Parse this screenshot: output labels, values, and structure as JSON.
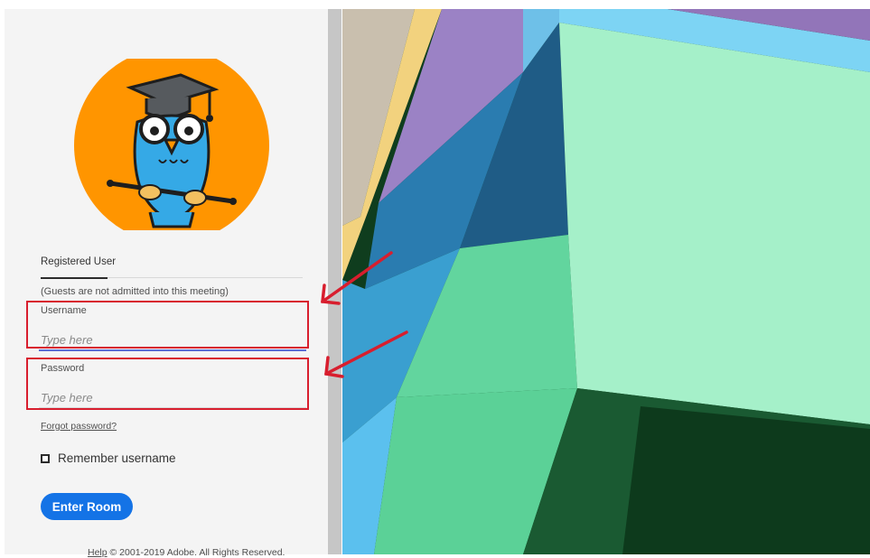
{
  "login": {
    "tab_label": "Registered User",
    "guest_note": "(Guests are not admitted into this meeting)",
    "username": {
      "label": "Username",
      "placeholder": "Type here",
      "value": ""
    },
    "password": {
      "label": "Password",
      "placeholder": "Type here",
      "value": ""
    },
    "forgot_password": "Forgot password?",
    "remember_username": {
      "label": "Remember username",
      "checked": false
    },
    "enter_button": "Enter Room"
  },
  "footer": {
    "help": "Help",
    "copyright": " © 2001-2019 Adobe. All Rights Reserved."
  },
  "logo": {
    "icon": "owl-graduate-logo-icon",
    "background_color": "#ff9500",
    "owl_color": "#35a9e6"
  },
  "annotations": {
    "highlight_color": "#d81e2e",
    "targets": [
      "username",
      "password"
    ]
  },
  "colors": {
    "primary_button": "#1473e6",
    "focus_underline": "#5a6fd6"
  }
}
